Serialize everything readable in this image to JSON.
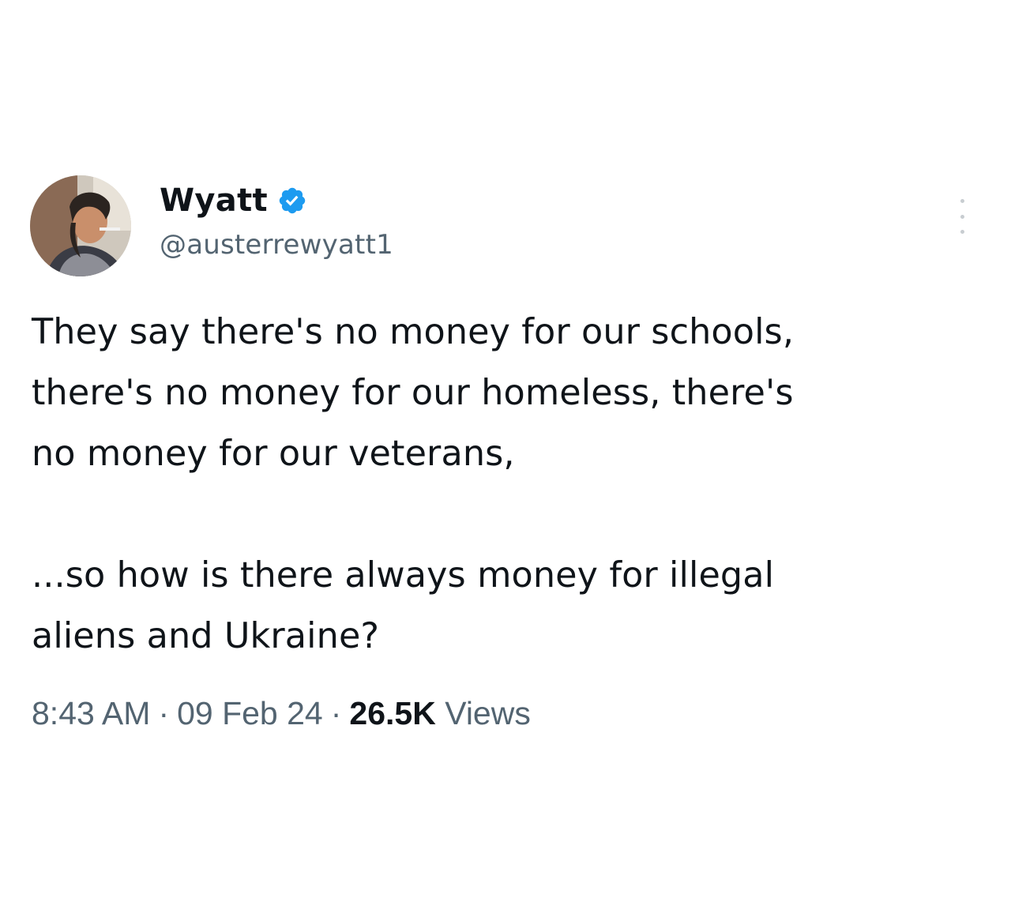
{
  "author": {
    "display_name": "Wyatt",
    "handle": "@austerrewyatt1",
    "verified": true,
    "avatar_icon": "avatar-photo"
  },
  "tweet": {
    "paragraphs": [
      "They say there's no money for our schools,\nthere's no money for our homeless, there's\nno money for our veterans,",
      "...so how is there always money for illegal\naliens and Ukraine?"
    ]
  },
  "meta": {
    "time": "8:43 AM",
    "separator": "·",
    "date": "09 Feb 24",
    "views_count": "26.5K",
    "views_label": "Views"
  },
  "icons": {
    "verified": "verified-badge-icon",
    "more": "more-options-icon"
  },
  "colors": {
    "text_primary": "#0f1419",
    "text_secondary": "#536471",
    "verified_blue": "#1d9bf0"
  }
}
